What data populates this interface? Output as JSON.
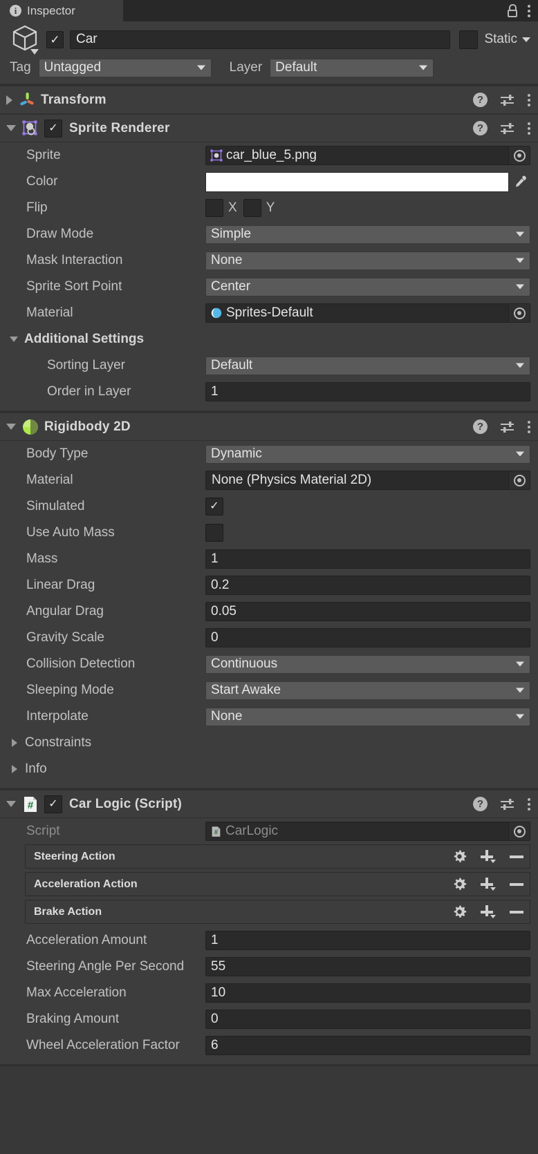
{
  "window": {
    "tab_label": "Inspector",
    "tab_icon": "info-icon",
    "lock_icon": "lock-open-icon",
    "menu_icon": "kebab-menu-icon"
  },
  "object_header": {
    "prefab_icon": "cube-icon",
    "enabled": true,
    "name": "Car",
    "static_label": "Static",
    "static_checked": false,
    "tag_label": "Tag",
    "tag_value": "Untagged",
    "layer_label": "Layer",
    "layer_value": "Default"
  },
  "components": [
    {
      "name": "Transform",
      "icon": "transform-axis-icon",
      "expanded": false,
      "has_enable_toggle": false
    },
    {
      "name": "Sprite Renderer",
      "icon": "sprite-renderer-icon",
      "expanded": true,
      "has_enable_toggle": true,
      "enabled": true,
      "fields": [
        {
          "label": "Sprite",
          "type": "object",
          "value": "car_blue_5.png",
          "icon": "sprite-asset-icon"
        },
        {
          "label": "Color",
          "type": "color",
          "value": "#FFFFFF",
          "picker_icon": "eyedropper-icon"
        },
        {
          "label": "Flip",
          "type": "flip",
          "x_label": "X",
          "y_label": "Y",
          "x": false,
          "y": false
        },
        {
          "label": "Draw Mode",
          "type": "dropdown",
          "value": "Simple"
        },
        {
          "label": "Mask Interaction",
          "type": "dropdown",
          "value": "None"
        },
        {
          "label": "Sprite Sort Point",
          "type": "dropdown",
          "value": "Center"
        },
        {
          "label": "Material",
          "type": "object",
          "value": "Sprites-Default",
          "icon": "material-sphere-icon"
        },
        {
          "label": "Additional Settings",
          "type": "subheader",
          "expanded": true
        },
        {
          "label": "Sorting Layer",
          "type": "dropdown",
          "value": "Default",
          "indent": true
        },
        {
          "label": "Order in Layer",
          "type": "text",
          "value": "1",
          "indent": true
        }
      ]
    },
    {
      "name": "Rigidbody 2D",
      "icon": "rigidbody2d-icon",
      "expanded": true,
      "has_enable_toggle": false,
      "fields": [
        {
          "label": "Body Type",
          "type": "dropdown",
          "value": "Dynamic"
        },
        {
          "label": "Material",
          "type": "object",
          "value": "None (Physics Material 2D)"
        },
        {
          "label": "Simulated",
          "type": "checkbox",
          "checked": true
        },
        {
          "label": "Use Auto Mass",
          "type": "checkbox",
          "checked": false
        },
        {
          "label": "Mass",
          "type": "text",
          "value": "1"
        },
        {
          "label": "Linear Drag",
          "type": "text",
          "value": "0.2"
        },
        {
          "label": "Angular Drag",
          "type": "text",
          "value": "0.05"
        },
        {
          "label": "Gravity Scale",
          "type": "text",
          "value": "0"
        },
        {
          "label": "Collision Detection",
          "type": "dropdown",
          "value": "Continuous"
        },
        {
          "label": "Sleeping Mode",
          "type": "dropdown",
          "value": "Start Awake"
        },
        {
          "label": "Interpolate",
          "type": "dropdown",
          "value": "None"
        },
        {
          "label": "Constraints",
          "type": "foldout",
          "expanded": false
        },
        {
          "label": "Info",
          "type": "foldout",
          "expanded": false
        }
      ]
    },
    {
      "name": "Car Logic (Script)",
      "icon": "csharp-script-icon",
      "expanded": true,
      "has_enable_toggle": true,
      "enabled": true,
      "fields": [
        {
          "label": "Script",
          "type": "object",
          "value": "CarLogic",
          "icon": "csharp-script-icon",
          "dim": true
        },
        {
          "label": "Steering Action",
          "type": "action"
        },
        {
          "label": "Acceleration Action",
          "type": "action"
        },
        {
          "label": "Brake Action",
          "type": "action"
        },
        {
          "label": "Acceleration Amount",
          "type": "text",
          "value": "1"
        },
        {
          "label": "Steering Angle Per Second",
          "type": "text",
          "value": "55"
        },
        {
          "label": "Max Acceleration",
          "type": "text",
          "value": "10"
        },
        {
          "label": "Braking Amount",
          "type": "text",
          "value": "0"
        },
        {
          "label": "Wheel Acceleration Factor",
          "type": "text",
          "value": "6"
        }
      ],
      "action_icons": {
        "settings": "gear-icon",
        "add": "plus-dropdown-icon",
        "remove": "minus-icon"
      }
    }
  ],
  "component_header_icons": {
    "help": "help-icon",
    "preset": "preset-sliders-icon",
    "menu": "kebab-menu-icon"
  },
  "colors": {
    "panel_bg": "#383838",
    "component_bg": "#3d3d3d",
    "tabbar_bg": "#282828",
    "field_bg": "#2a2a2a",
    "dropdown_bg": "#5a5a5a",
    "text": "#c2c2c2",
    "text_bright": "#e4e4e4",
    "text_dim": "#8d8d8d",
    "divider": "#303030",
    "rigidbody_icon": "#b0e84a",
    "sprite_icon": "#a07cf0",
    "material_icon": "#56b8e8",
    "script_icon": "#1a7a35",
    "color_value": "#FFFFFF"
  }
}
